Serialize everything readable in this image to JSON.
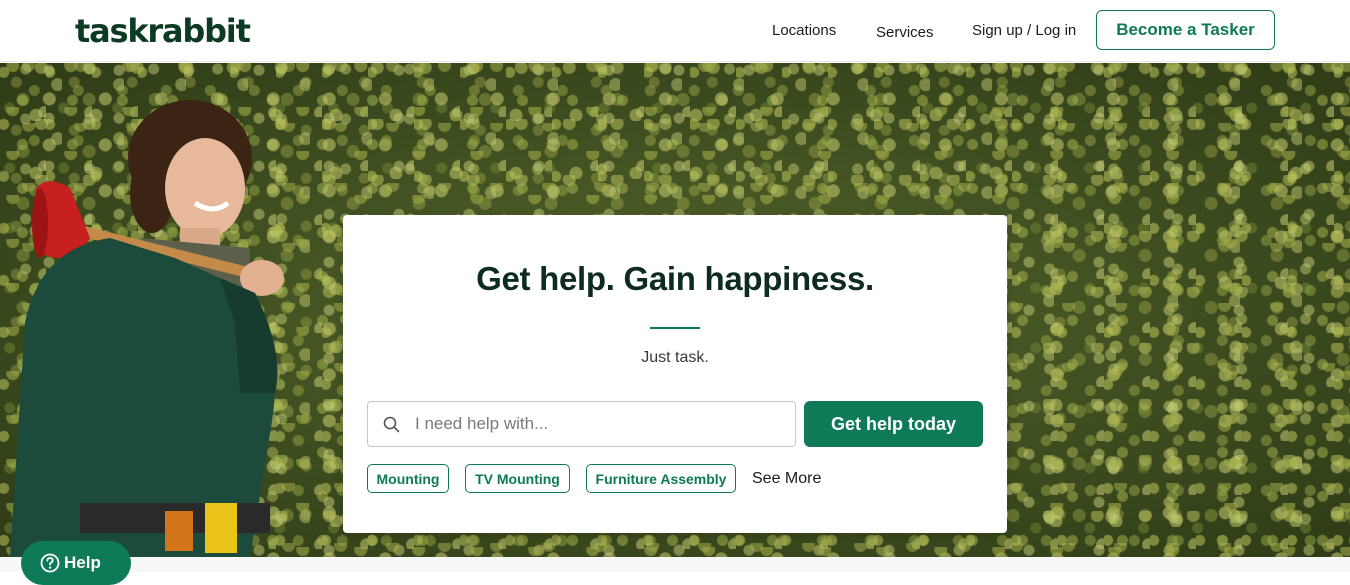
{
  "header": {
    "logo": "taskrabbit",
    "nav": {
      "locations": "Locations",
      "services": "Services",
      "signup": "Sign up / Log in"
    },
    "become_tasker": "Become a Tasker"
  },
  "hero": {
    "title": "Get help. Gain happiness.",
    "subtitle": "Just task.",
    "search": {
      "placeholder": "I need help with...",
      "value": ""
    },
    "cta": "Get help today",
    "chips": [
      "Mounting",
      "TV Mounting",
      "Furniture Assembly"
    ],
    "see_more": "See More"
  },
  "help_widget": {
    "label": "Help"
  },
  "colors": {
    "brand_green": "#0f7a57",
    "logo_dark_green": "#0d3a22",
    "title_text": "#0d2b22"
  },
  "icons": {
    "search": "search-icon",
    "help": "help-question-icon"
  }
}
